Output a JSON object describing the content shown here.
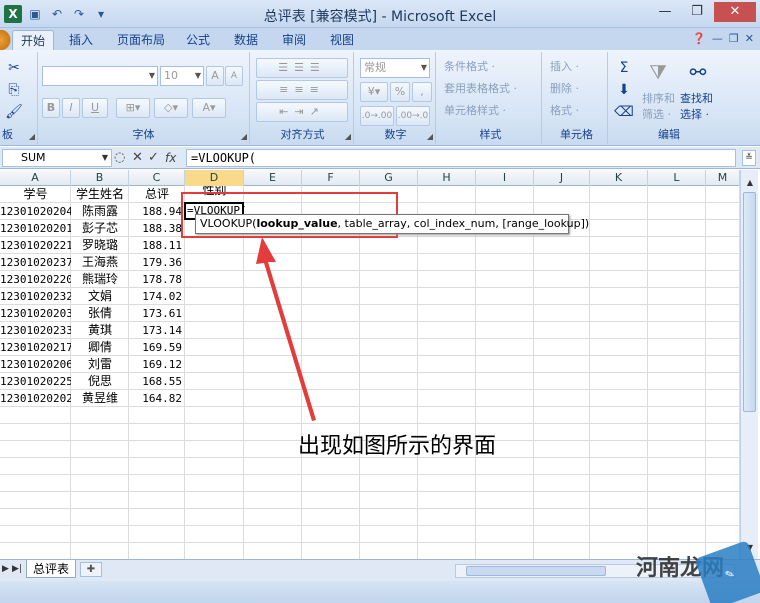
{
  "window": {
    "title": "总评表  [兼容模式] - Microsoft Excel",
    "qat_icons": [
      "excel-logo-icon",
      "save-icon",
      "undo-icon",
      "redo-icon"
    ],
    "controls": [
      "—",
      "❐",
      "✕"
    ]
  },
  "tabs": [
    "开始",
    "插入",
    "页面布局",
    "公式",
    "数据",
    "审阅",
    "视图"
  ],
  "ribbon": {
    "groups": {
      "clipboard": "板",
      "font": "字体",
      "alignment": "对齐方式",
      "number": "数字",
      "styles": "样式",
      "cells": "单元格",
      "editing": "编辑"
    },
    "font_size": "10",
    "number_format": "常规",
    "styles_items": [
      "条件格式 ·",
      "套用表格格式 ·",
      "单元格样式 ·"
    ],
    "cells_items": [
      "插入 ·",
      "删除 ·",
      "格式 ·"
    ],
    "editing": {
      "sort_filter": [
        "排序和",
        "筛选 ·"
      ],
      "find_select": [
        "查找和",
        "选择 ·"
      ]
    },
    "font_buttons": [
      "B",
      "I",
      "U"
    ],
    "grow_shrink": [
      "A",
      "A"
    ],
    "percent": "%",
    "comma": ","
  },
  "formula_bar": {
    "name_box": "SUM",
    "formula": "=VLOOKUP("
  },
  "grid": {
    "columns": [
      "A",
      "B",
      "C",
      "D",
      "E",
      "F",
      "G",
      "H",
      "I",
      "J",
      "K",
      "L",
      "M"
    ],
    "headers": [
      "学号",
      "学生姓名",
      "总评",
      "性别"
    ],
    "rows": [
      {
        "id": "12301020204",
        "name": "陈雨露",
        "score": "188.94"
      },
      {
        "id": "12301020201",
        "name": "彭子芯",
        "score": "188.38"
      },
      {
        "id": "12301020221",
        "name": "罗晓璐",
        "score": "188.11"
      },
      {
        "id": "12301020237",
        "name": "王海燕",
        "score": "179.36"
      },
      {
        "id": "12301020220",
        "name": "熊瑞玲",
        "score": "178.78"
      },
      {
        "id": "12301020232",
        "name": "文娟",
        "score": "174.02"
      },
      {
        "id": "12301020203",
        "name": "张倩",
        "score": "173.61"
      },
      {
        "id": "12301020233",
        "name": "黄琪",
        "score": "173.14"
      },
      {
        "id": "12301020217",
        "name": "卿倩",
        "score": "169.59"
      },
      {
        "id": "12301020206",
        "name": "刘雷",
        "score": "169.12"
      },
      {
        "id": "12301020225",
        "name": "倪思",
        "score": "168.55"
      },
      {
        "id": "12301020202",
        "name": "黄昱维",
        "score": "164.82"
      }
    ],
    "active_cell_text": "=VLOOKUP("
  },
  "tooltip": {
    "fn": "VLOOKUP(",
    "arg1": "lookup_value",
    "rest": ", table_array, col_index_num, [range_lookup])"
  },
  "annotation": "出现如图所示的界面",
  "sheet_tab": "总评表",
  "watermark": "河南龙网",
  "colors": {
    "annotation_red": "#e33c3c",
    "ribbon_blue": "#15428b"
  }
}
